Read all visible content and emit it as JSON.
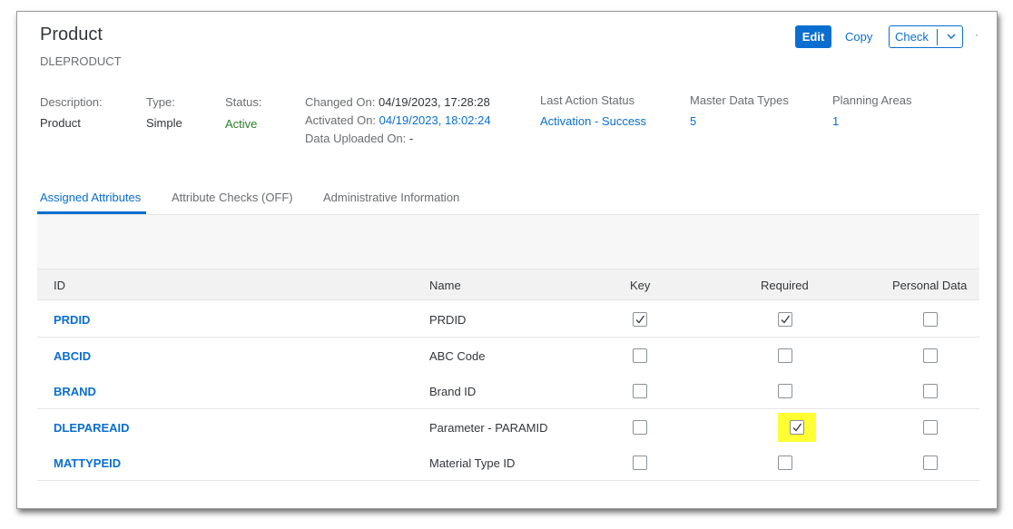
{
  "header": {
    "title": "Product",
    "subtitle": "DLEPRODUCT",
    "actions": {
      "edit": "Edit",
      "copy": "Copy",
      "check": "Check"
    }
  },
  "info": {
    "description": {
      "label": "Description:",
      "value": "Product"
    },
    "type": {
      "label": "Type:",
      "value": "Simple"
    },
    "status": {
      "label": "Status:",
      "value": "Active"
    },
    "changed_on": {
      "label": "Changed On:",
      "value": "04/19/2023, 17:28:28"
    },
    "activated_on": {
      "label": "Activated On:",
      "value": "04/19/2023, 18:02:24"
    },
    "data_uploaded_on": {
      "label": "Data Uploaded On:",
      "value": "-"
    },
    "last_action_status": {
      "label": "Last Action Status",
      "value": "Activation - Success"
    },
    "master_data_types": {
      "label": "Master Data Types",
      "value": "5"
    },
    "planning_areas": {
      "label": "Planning Areas",
      "value": "1"
    }
  },
  "tabs": [
    {
      "label": "Assigned Attributes",
      "active": true
    },
    {
      "label": "Attribute Checks (OFF)",
      "active": false
    },
    {
      "label": "Administrative Information",
      "active": false
    }
  ],
  "table": {
    "columns": [
      "ID",
      "Name",
      "Key",
      "Required",
      "Personal Data"
    ],
    "rows": [
      {
        "id": "PRDID",
        "name": "PRDID",
        "key": true,
        "required": true,
        "personal": false
      },
      {
        "id": "ABCID",
        "name": "ABC Code",
        "key": false,
        "required": false,
        "personal": false
      },
      {
        "id": "BRAND",
        "name": "Brand ID",
        "key": false,
        "required": false,
        "personal": false
      },
      {
        "id": "DLEPAREAID",
        "name": "Parameter - PARAMID",
        "key": false,
        "required": true,
        "personal": false,
        "highlight_required": true
      },
      {
        "id": "MATTYPEID",
        "name": "Material Type ID",
        "key": false,
        "required": false,
        "personal": false
      }
    ]
  },
  "colors": {
    "accent": "#0a6ed1",
    "status_active": "#2b7d2b",
    "highlight": "#ffff33"
  },
  "icons": {
    "check_dropdown": "chevron-down-icon",
    "checkbox_checked": "checkmark-icon"
  }
}
